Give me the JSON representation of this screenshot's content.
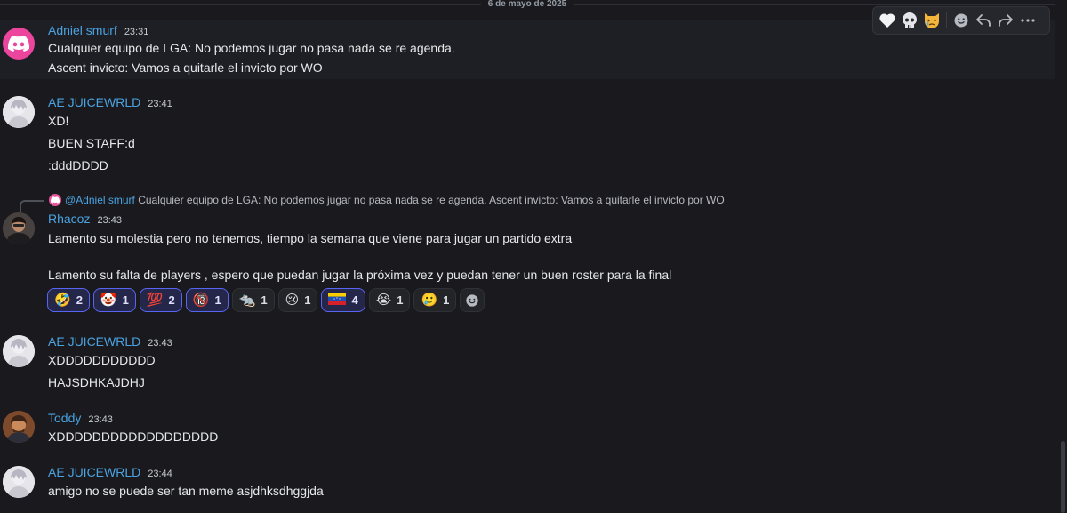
{
  "date_divider": "6 de mayo de 2025",
  "toolbar": {
    "icons": [
      "white-heart-icon",
      "skull-icon",
      "crying-cat-icon",
      "add-reaction-icon",
      "reply-icon",
      "forward-icon",
      "more-icon"
    ],
    "emoji": [
      "🤍",
      "💀",
      "😿"
    ]
  },
  "messages": [
    {
      "author": "Adniel smurf",
      "time": "23:31",
      "lines": [
        "Cualquier equipo de LGA: No podemos jugar no pasa nada se re agenda.",
        "Ascent invicto: Vamos a quitarle el invicto por WO"
      ]
    },
    {
      "author": "AE JUICEWRLD",
      "time": "23:41",
      "lines": [
        "XD!",
        "BUEN STAFF:d",
        ":dddDDDD"
      ]
    },
    {
      "reply": {
        "mention": "@Adniel smurf",
        "text": "Cualquier equipo de LGA: No podemos jugar no pasa nada se re agenda. Ascent invicto: Vamos a quitarle el invicto por WO"
      },
      "author": "Rhacoz",
      "time": "23:43",
      "lines": [
        "Lamento su molestia pero no tenemos, tiempo la semana que viene para jugar un partido extra",
        "Lamento su falta de players , espero que puedan jugar la próxima vez y puedan tener un buen roster para la final"
      ],
      "reactions": [
        {
          "emoji": "🤣",
          "count": "2",
          "me": true
        },
        {
          "emoji": "🤡",
          "count": "1",
          "me": true
        },
        {
          "emoji": "💯",
          "count": "2",
          "me": true
        },
        {
          "emoji": "🔞",
          "count": "1",
          "me": true
        },
        {
          "emoji": "🐀",
          "count": "1",
          "me": false
        },
        {
          "emoji": "😢",
          "count": "1",
          "me": false
        },
        {
          "emoji": "🇻🇪",
          "count": "4",
          "me": true
        },
        {
          "emoji": "😭",
          "count": "1",
          "me": false
        },
        {
          "emoji": "🥲",
          "count": "1",
          "me": false
        }
      ]
    },
    {
      "author": "AE JUICEWRLD",
      "time": "23:43",
      "lines": [
        "XDDDDDDDDDDD",
        "HAJSDHKAJDHJ"
      ]
    },
    {
      "author": "Toddy",
      "time": "23:43",
      "lines": [
        "XDDDDDDDDDDDDDDDDDD"
      ]
    },
    {
      "author": "AE JUICEWRLD",
      "time": "23:44",
      "lines": [
        "amigo no se puede ser tan meme asjdhksdhggjda"
      ]
    }
  ]
}
